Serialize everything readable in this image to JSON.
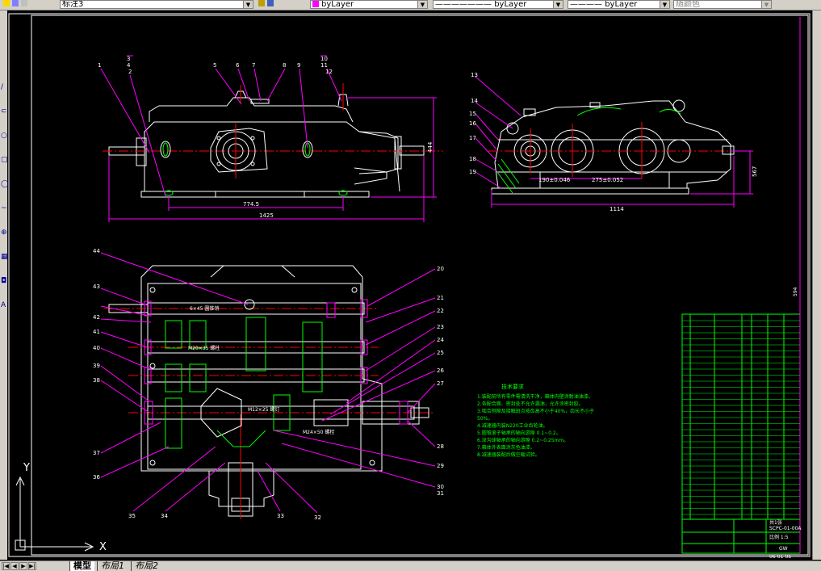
{
  "toolbar": {
    "dimstyle_value": "标注3",
    "layer_value": "byLayer",
    "linetype_value": "byLayer",
    "lineweight_value": "byLayer",
    "plotstyle_value": "随颜色"
  },
  "colors": {
    "background": "#000000",
    "geometry": "#ffffff",
    "dimension": "#ff00ff",
    "centerline": "#ff0000",
    "hatch": "#00ff00",
    "text": "#00ff00",
    "frame": "#00ff00"
  },
  "drawing": {
    "front_view": {
      "dims": [
        "774.5",
        "1425",
        "444"
      ],
      "labels": [
        "1",
        "2",
        "3",
        "4",
        "5",
        "6",
        "7",
        "8",
        "9",
        "10",
        "11",
        "12"
      ]
    },
    "side_view": {
      "dims": [
        "190±0.046",
        "275±0.052",
        "1114",
        "567"
      ],
      "labels": [
        "13",
        "14",
        "15",
        "16",
        "17",
        "18",
        "19"
      ]
    },
    "plan_view": {
      "left_labels": [
        "44",
        "43",
        "42",
        "41",
        "40",
        "39",
        "38",
        "37",
        "36"
      ],
      "right_labels": [
        "20",
        "21",
        "22",
        "23",
        "24",
        "25",
        "26",
        "27",
        "28",
        "29",
        "30",
        "31"
      ],
      "bottom_labels": [
        "35",
        "34",
        "33",
        "32"
      ],
      "shaft_notes": [
        "6×45 圆锥销",
        "M20×35 螺柱",
        "M12×25 螺钉",
        "M24×50 螺栓"
      ]
    },
    "tech_req": {
      "title": "技术要求",
      "lines": [
        "1.装配前所有零件需清洗干净，箱体内壁涂耐油油漆。",
        "2.各配合面、密封处不允许漏油，允许涂密封胶。",
        "3.啮合侧隙及接触斑点按齿高不小于40%，齿长不小于",
        "  50%。",
        "4.减速器内装N220工业齿轮油。",
        "5.圆锥滚子轴承的轴向游隙 0.1~0.2。",
        "6.深沟球轴承的轴向游隙 0.2~0.25mm。",
        "7.箱体外表面涂灰色油漆。",
        "8.减速器装配后做空载试验。"
      ]
    },
    "title_block": {
      "drawing_no": "SCPC-01-00A",
      "scale": "比例 1:5",
      "sheet": "共1张",
      "date": "06-01-05",
      "unit": "GW",
      "dim_right": "594"
    }
  },
  "tabs": {
    "model": "模型",
    "layout1": "布局1",
    "layout2": "布局2"
  },
  "ucs": {
    "x_label": "X",
    "y_label": "Y"
  }
}
